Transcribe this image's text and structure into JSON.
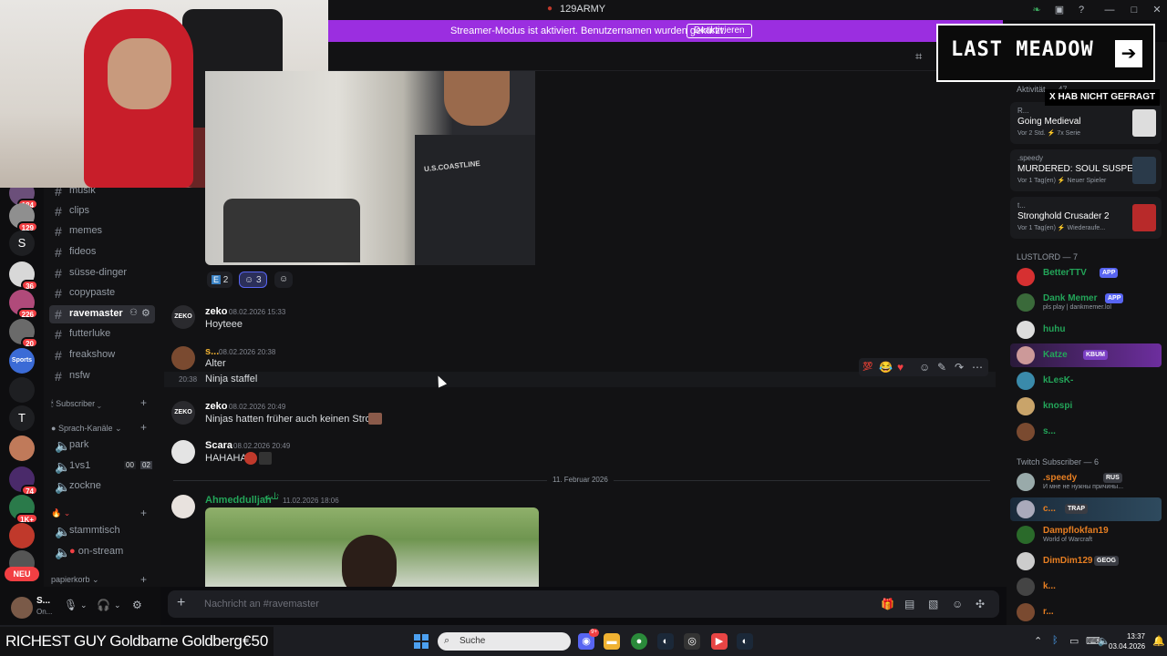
{
  "window": {
    "title": "129ARMY"
  },
  "banner": {
    "message": "Streamer-Modus ist aktiviert. Benutzernamen wurden gekürzt.",
    "button": "Deaktivieren"
  },
  "servers": {
    "badges": [
      "184",
      "129",
      "36",
      "226",
      "20",
      "74",
      "1K+"
    ],
    "letters": [
      "S",
      "T"
    ],
    "sports_label": "Sports",
    "new_label": "NEU"
  },
  "channels": {
    "text": [
      "musik",
      "clips",
      "memes",
      "fideos",
      "süsse-dinger",
      "copypaste",
      "ravemaster",
      "futterluke",
      "freakshow",
      "nsfw"
    ],
    "active": "ravemaster",
    "cat_subscriber": "Subscriber",
    "cat_voice": "Sprach-Kanäle",
    "voice": [
      "park",
      "1vs1",
      "zockne"
    ],
    "voice_counts": [
      "00",
      "02"
    ],
    "stammtisch": "stammtisch",
    "on_stream": "on-stream",
    "cat_papierkorb": "papierkorb"
  },
  "user_panel": {
    "name": "S...",
    "status": "On..."
  },
  "messages": {
    "reactions": [
      "2",
      "3"
    ],
    "m1": {
      "author": "zeko",
      "time": "08.02.2026 15:33",
      "text": "Hoyteee",
      "avatar": "ZEKO"
    },
    "m2": {
      "author": "s...",
      "time": "08.02.2026 20:38",
      "text": "Alter"
    },
    "m2b": {
      "time": "20:38",
      "text": "Ninja staffel"
    },
    "m3": {
      "author": "zeko",
      "time": "08.02.2026 20:49",
      "text": "Ninjas hatten früher auch keinen Strom",
      "avatar": "ZEKO"
    },
    "m4": {
      "author": "Scara",
      "time": "08.02.2026 20:49",
      "text": "HAHAHA"
    },
    "divider": "11. Februar 2026",
    "m5": {
      "author": "Ahmeddulljah",
      "suffix": "ثلث",
      "time": "11.02.2026 18:06"
    },
    "shirt_text": "U.S.COASTLINE"
  },
  "input": {
    "placeholder": "Nachricht an #ravemaster"
  },
  "members": {
    "activity_header": "Aktivität",
    "activity_count": "47",
    "activities": [
      {
        "user": "R...",
        "game": "Going Medieval",
        "meta": "Vor 2 Std.  ⚡ 7x Serie"
      },
      {
        "user": ".speedy",
        "game": "MURDERED: SOUL SUSPE...",
        "meta": "Vor 1 Tag(en)  ⚡ Neuer Spieler"
      },
      {
        "user": "t...",
        "game": "Stronghold Crusader 2",
        "meta": "Vor 1 Tag(en)  ⚡ Wiederaufe..."
      }
    ],
    "lustlord_header": "LUSTLORD — 7",
    "lustlord": [
      {
        "name": "BetterTTV",
        "tag": "APP",
        "color": "#23a559"
      },
      {
        "name": "Dank Memer",
        "tag": "APP",
        "sub": "pls play | dankmemer.lol",
        "color": "#23a559"
      },
      {
        "name": "huhu",
        "color": "#23a559"
      },
      {
        "name": "Katze",
        "tag": "KBUM",
        "color": "#23a559"
      },
      {
        "name": "kLesK-",
        "color": "#23a559"
      },
      {
        "name": "knospi",
        "color": "#23a559"
      },
      {
        "name": "s...",
        "color": "#23a559"
      }
    ],
    "twitch_header": "Twitch Subscriber — 6",
    "twitch": [
      {
        "name": ".speedy",
        "tag": "RUS",
        "sub": "И мне не нужны причины...",
        "color": "#e67e22"
      },
      {
        "name": "c...",
        "tag": "TRAP",
        "color": "#e67e22"
      },
      {
        "name": "Dampflokfan19",
        "sub": "World of Warcraft",
        "color": "#e67e22"
      },
      {
        "name": "DimDim129",
        "tag": "GEOG",
        "color": "#e67e22"
      },
      {
        "name": "k...",
        "color": "#e67e22"
      },
      {
        "name": "r...",
        "color": "#e67e22"
      }
    ]
  },
  "overlay": {
    "title": "LAST MEADOW",
    "caption": "X HAB NICHT GEFRAGT"
  },
  "ticker": {
    "text": "RICHEST GUY Goldbarne Goldberg",
    "price": "€50"
  },
  "taskbar": {
    "search_placeholder": "Suche",
    "time": "13:37",
    "date": "03.04.2026",
    "discord_badge": "9+"
  }
}
